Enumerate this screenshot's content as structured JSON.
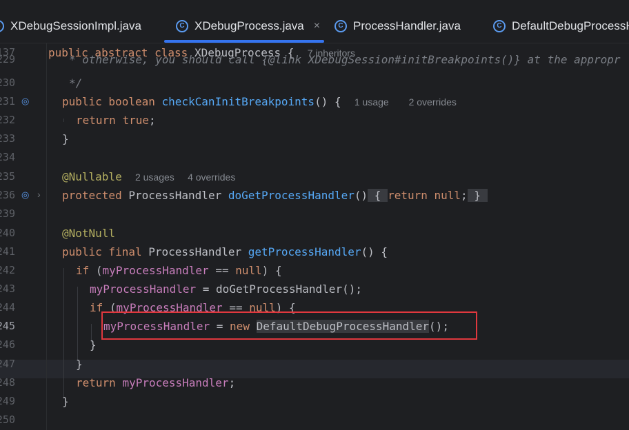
{
  "tabs": [
    {
      "label": "XDebugSessionImpl.java",
      "icon": "class-icon"
    },
    {
      "label": "XDebugProcess.java",
      "icon": "class-icon",
      "active": true,
      "close": "×"
    },
    {
      "label": "ProcessHandler.java",
      "icon": "class-icon"
    },
    {
      "label": "DefaultDebugProcessH",
      "icon": "class-icon"
    }
  ],
  "sticky": {
    "line_number": "137",
    "code": {
      "kw": "public abstract class",
      "name": "XDebugProcess",
      "brace": "{",
      "hint": "7 inheritors"
    }
  },
  "lines": [
    {
      "n": "229",
      "comment": "* otherwise, you should call {@link XDebugSession#initBreakpoints()} at the appropr"
    },
    {
      "n": "230",
      "comment": "*/"
    },
    {
      "n": "231",
      "kw": "public boolean",
      "fn": "checkCanInitBreakpoints",
      "rest": "() {",
      "hint1": "1 usage",
      "hint2": "2 overrides"
    },
    {
      "n": "232",
      "kw": "return",
      "val": "true",
      "rest": ";"
    },
    {
      "n": "233",
      "rest": "}"
    },
    {
      "n": "234"
    },
    {
      "n": "235",
      "ann": "@Nullable",
      "hint1": "2 usages",
      "hint2": "4 overrides"
    },
    {
      "n": "236",
      "kw": "protected",
      "type": "ProcessHandler",
      "fn": "doGetProcessHandler",
      "paren": "()",
      "fold_open": "{",
      "ret": "return",
      "val": "null",
      "semi": ";",
      "fold_close": "}"
    },
    {
      "n": "239"
    },
    {
      "n": "240",
      "ann": "@NotNull"
    },
    {
      "n": "241",
      "kw": "public final",
      "type": "ProcessHandler",
      "fn": "getProcessHandler",
      "rest": "() {"
    },
    {
      "n": "242",
      "kw": "if",
      "open": "(",
      "fld": "myProcessHandler",
      "op": "==",
      "val": "null",
      "rest": ") {"
    },
    {
      "n": "243",
      "fld": "myProcessHandler",
      "op": "=",
      "rest": "doGetProcessHandler();"
    },
    {
      "n": "244",
      "kw": "if",
      "open": "(",
      "fld": "myProcessHandler",
      "op": "==",
      "val": "null",
      "rest": ") {"
    },
    {
      "n": "245",
      "fld": "myProcessHandler",
      "op": "=",
      "kw": "new",
      "type": "DefaultDebugProcessHandler",
      "rest": "();"
    },
    {
      "n": "246",
      "rest": "}"
    },
    {
      "n": "247",
      "rest": "}"
    },
    {
      "n": "248",
      "kw": "return",
      "fld": "myProcessHandler",
      "rest": ";"
    },
    {
      "n": "249",
      "rest": "}"
    },
    {
      "n": "250"
    }
  ],
  "colors": {
    "keyword": "#cf8e6d",
    "function": "#56a8f5",
    "field": "#c77dbb",
    "annotation": "#b3ae60",
    "highlight_box": "#e0383e",
    "tab_underline": "#3574f0"
  }
}
